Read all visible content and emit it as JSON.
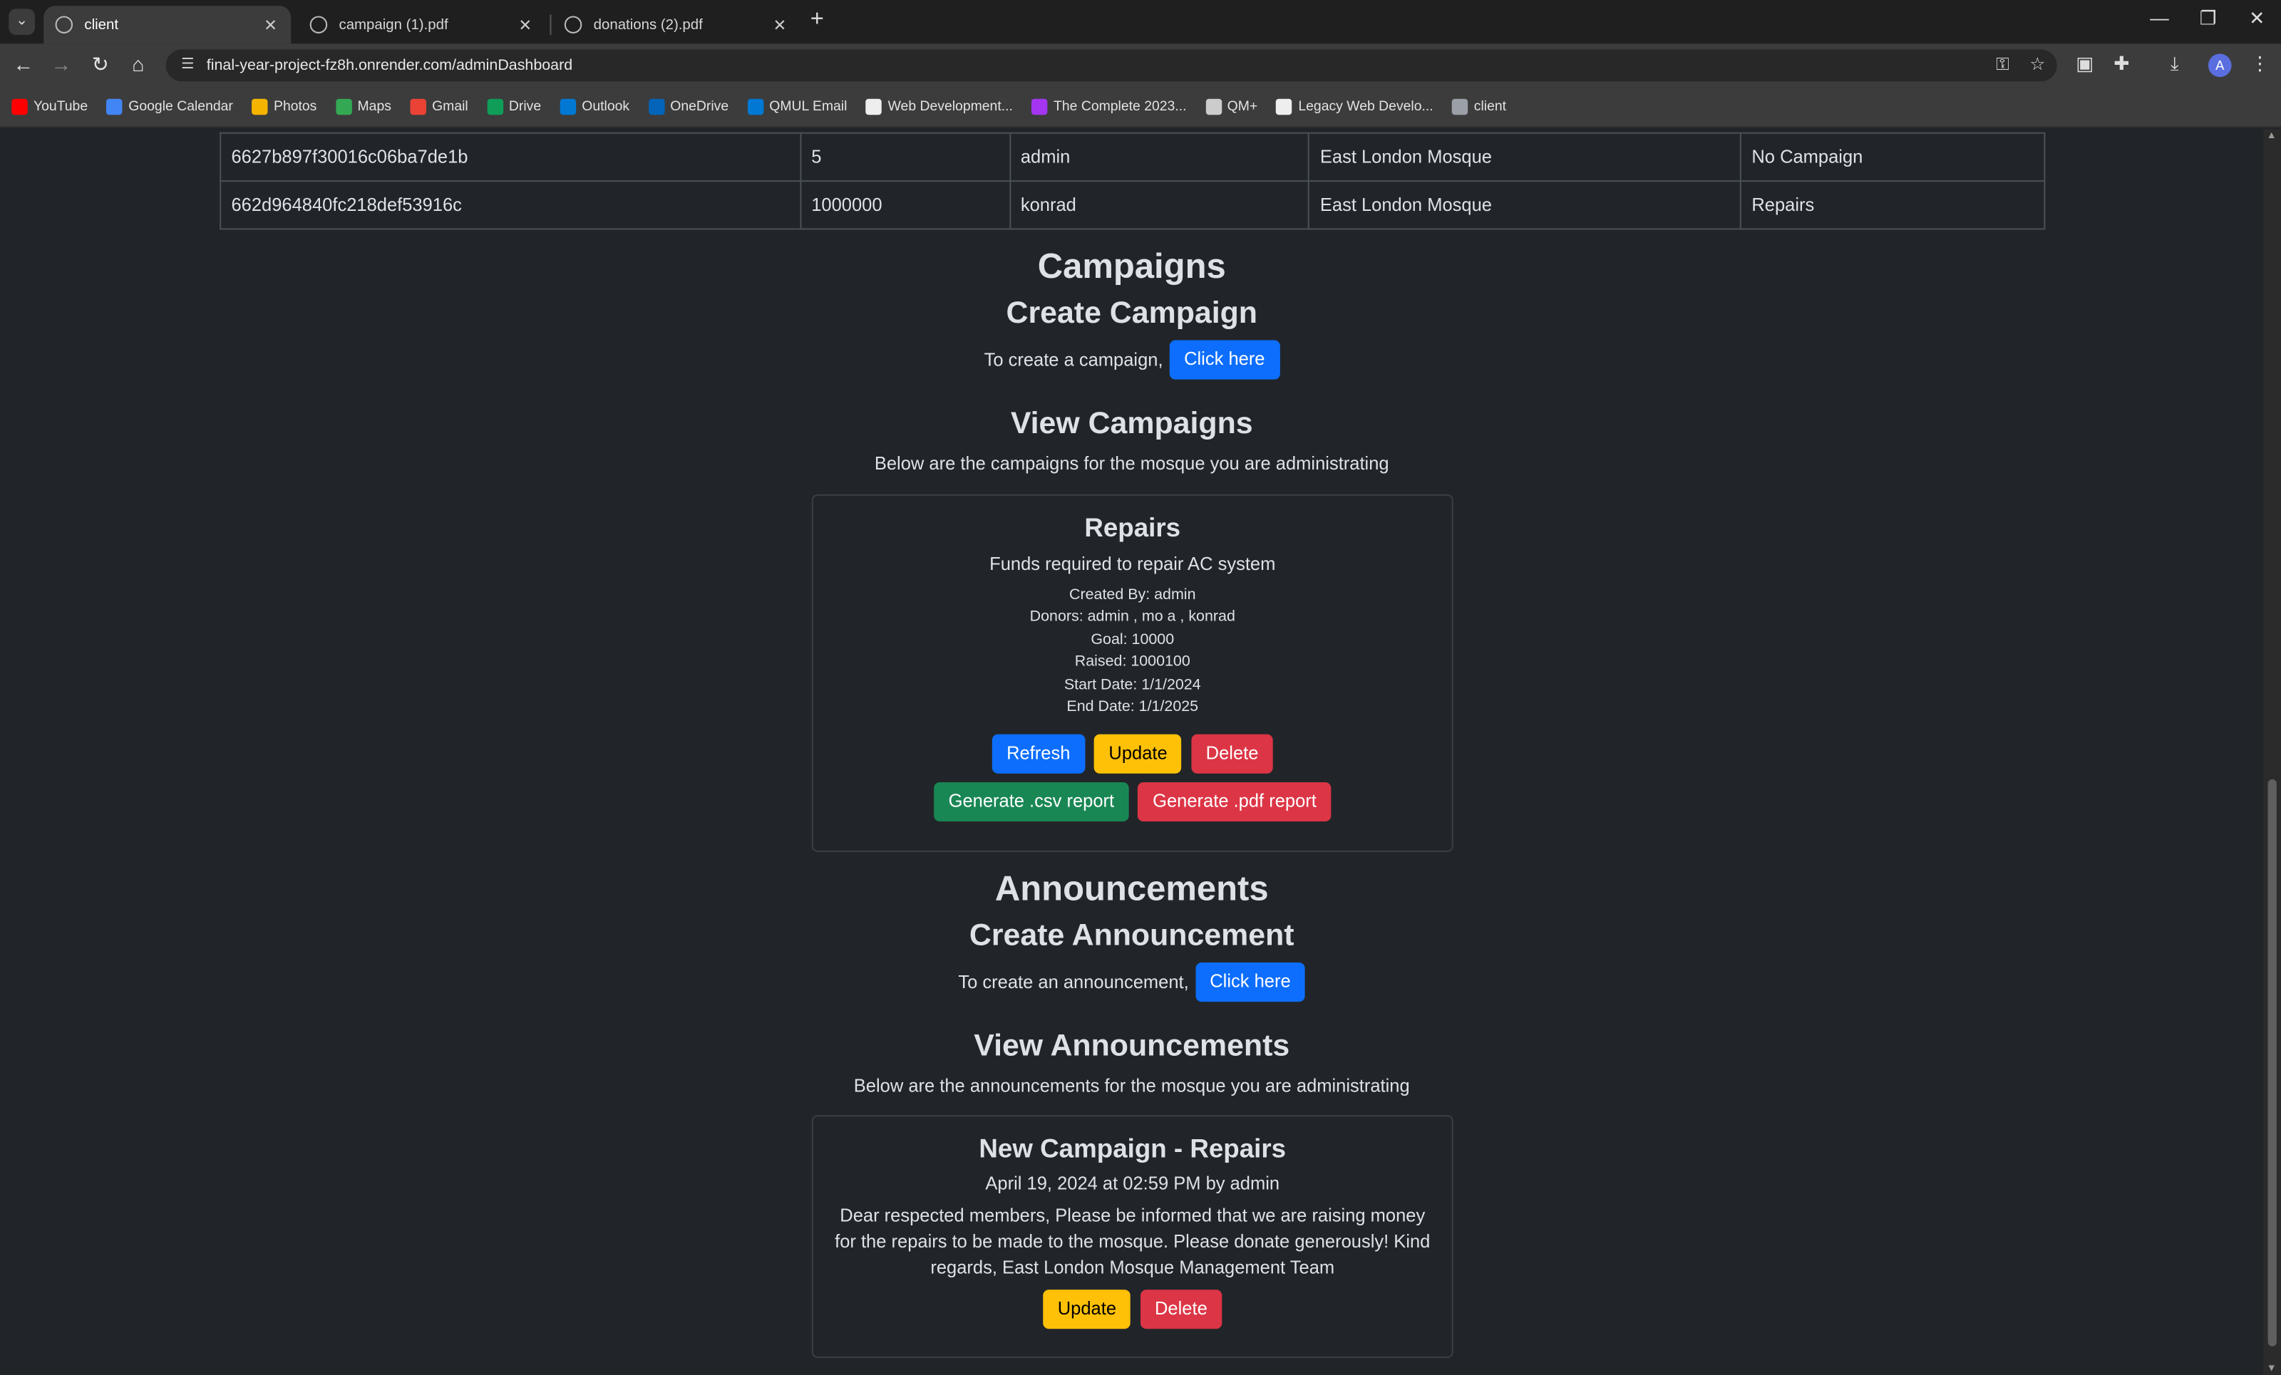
{
  "browser": {
    "tabs": [
      {
        "title": "client",
        "active": true
      },
      {
        "title": "campaign (1).pdf",
        "active": false
      },
      {
        "title": "donations (2).pdf",
        "active": false
      }
    ],
    "url": "final-year-project-fz8h.onrender.com/adminDashboard",
    "profile_initial": "A",
    "bookmarks": [
      {
        "label": "YouTube",
        "color": "#ff0000"
      },
      {
        "label": "Google Calendar",
        "color": "#4285f4"
      },
      {
        "label": "Photos",
        "color": "#f4b400"
      },
      {
        "label": "Maps",
        "color": "#34a853"
      },
      {
        "label": "Gmail",
        "color": "#ea4335"
      },
      {
        "label": "Drive",
        "color": "#0f9d58"
      },
      {
        "label": "Outlook",
        "color": "#0078d4"
      },
      {
        "label": "OneDrive",
        "color": "#0364b8"
      },
      {
        "label": "QMUL Email",
        "color": "#0078d4"
      },
      {
        "label": "Web Development...",
        "color": "#eeeeee"
      },
      {
        "label": "The Complete 2023...",
        "color": "#a435f0"
      },
      {
        "label": "QM+",
        "color": "#cccccc"
      },
      {
        "label": "Legacy Web Develo...",
        "color": "#eeeeee"
      },
      {
        "label": "client",
        "color": "#9aa0a6"
      }
    ]
  },
  "donations_table": {
    "rows": [
      [
        "6627b897f30016c06ba7de1b",
        "5",
        "admin",
        "East London Mosque",
        "No Campaign"
      ],
      [
        "662d964840fc218def53916c",
        "1000000",
        "konrad",
        "East London Mosque",
        "Repairs"
      ]
    ]
  },
  "campaigns": {
    "heading": "Campaigns",
    "create_heading": "Create Campaign",
    "create_text": "To create a campaign,",
    "create_button": "Click here",
    "view_heading": "View Campaigns",
    "view_text": "Below are the campaigns for the mosque you are administrating",
    "card": {
      "title": "Repairs",
      "description": "Funds required to repair AC system",
      "created_by": "Created By: admin",
      "donors": "Donors: admin , mo a , konrad",
      "goal": "Goal: 10000",
      "raised": "Raised: 1000100",
      "start_date": "Start Date: 1/1/2024",
      "end_date": "End Date: 1/1/2025",
      "refresh_label": "Refresh",
      "update_label": "Update",
      "delete_label": "Delete",
      "csv_label": "Generate .csv report",
      "pdf_label": "Generate .pdf report"
    }
  },
  "announcements": {
    "heading": "Announcements",
    "create_heading": "Create Announcement",
    "create_text": "To create an announcement,",
    "create_button": "Click here",
    "view_heading": "View Announcements",
    "view_text": "Below are the announcements for the mosque you are administrating",
    "card": {
      "title": "New Campaign - Repairs",
      "meta": "April 19, 2024 at 02:59 PM by admin",
      "body": "Dear respected members, Please be informed that we are raising money for the repairs to be made to the mosque. Please donate generously! Kind regards, East London Mosque Management Team",
      "update_label": "Update",
      "delete_label": "Delete"
    }
  }
}
